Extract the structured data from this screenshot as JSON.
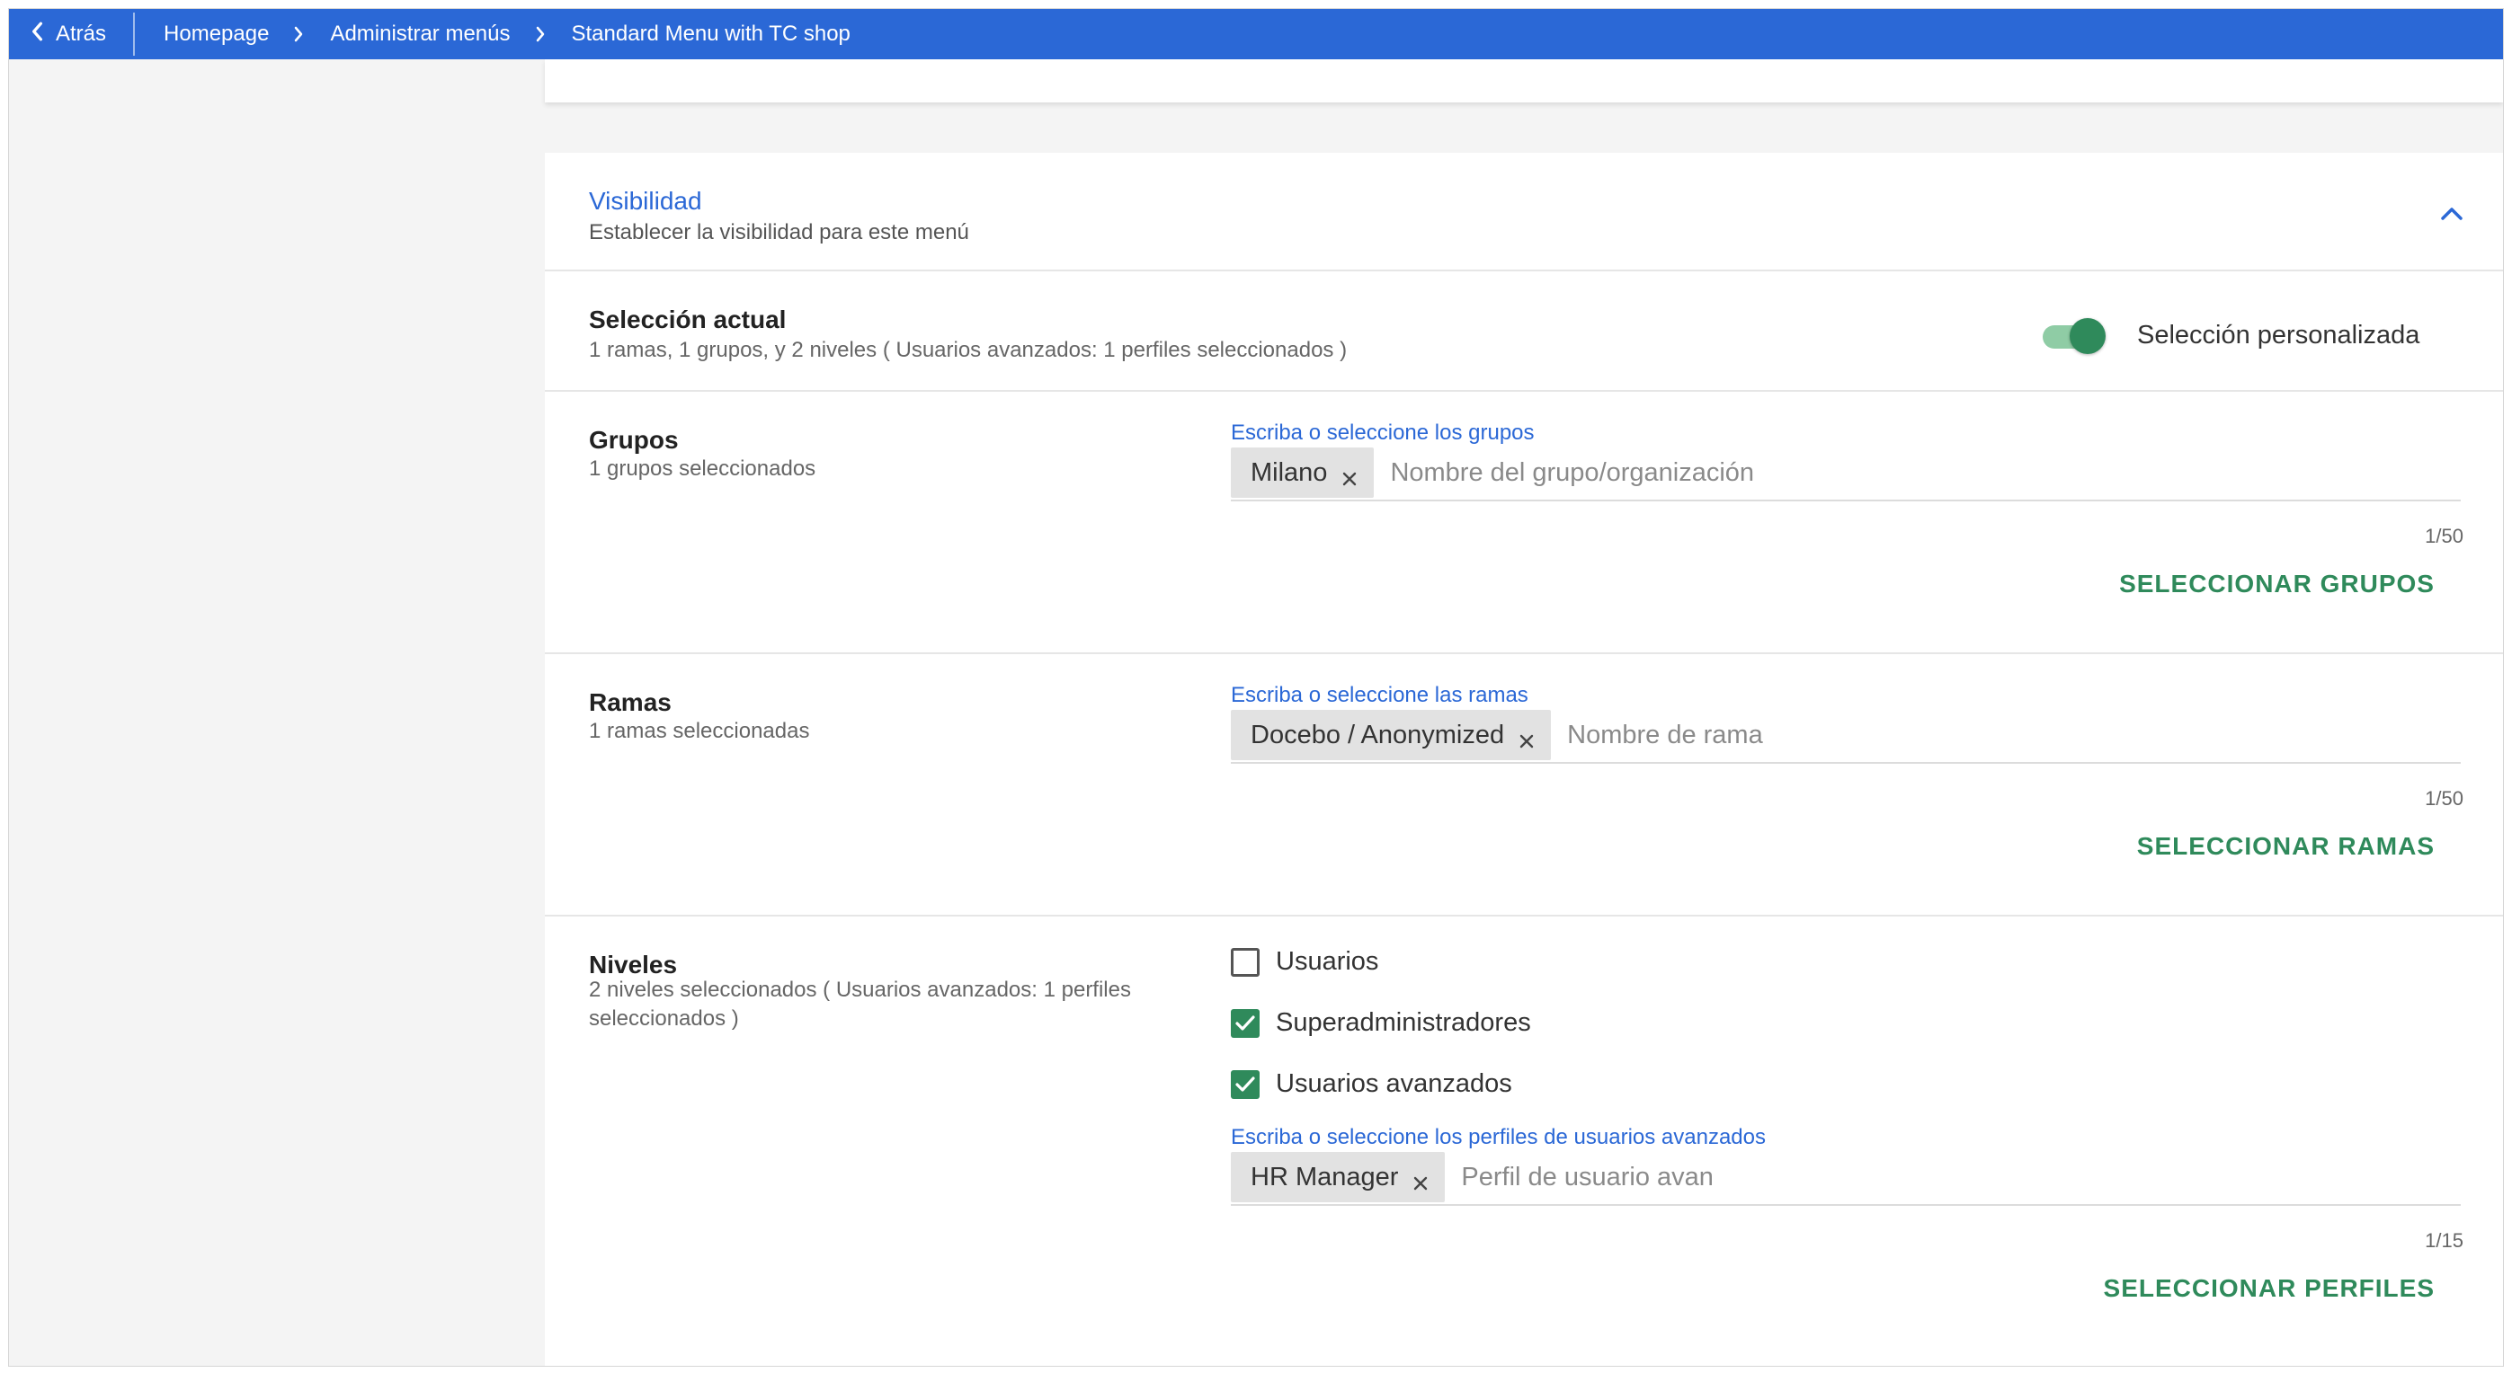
{
  "topbar": {
    "back_label": "Atrás",
    "breadcrumbs": [
      "Homepage",
      "Administrar menús",
      "Standard Menu with TC shop"
    ]
  },
  "visibility": {
    "title": "Visibilidad",
    "subtitle": "Establecer la visibilidad para este menú"
  },
  "current_selection": {
    "title": "Selección actual",
    "summary": "1 ramas, 1 grupos, y 2 niveles ( Usuarios avanzados: 1 perfiles seleccionados )",
    "toggle_label": "Selección personalizada",
    "toggle_on": true
  },
  "groups": {
    "title": "Grupos",
    "summary": "1 grupos seleccionados",
    "field_label": "Escriba o seleccione los grupos",
    "chips": [
      "Milano"
    ],
    "placeholder": "Nombre del grupo/organización",
    "counter": "1/50",
    "action": "SELECCIONAR GRUPOS"
  },
  "branches": {
    "title": "Ramas",
    "summary": "1 ramas seleccionadas",
    "field_label": "Escriba o seleccione las ramas",
    "chips": [
      "Docebo / Anonymized"
    ],
    "placeholder": "Nombre de rama",
    "counter": "1/50",
    "action": "SELECCIONAR RAMAS"
  },
  "levels": {
    "title": "Niveles",
    "summary": "2 niveles seleccionados ( Usuarios avanzados: 1 perfiles seleccionados )",
    "options": [
      {
        "label": "Usuarios",
        "checked": false
      },
      {
        "label": "Superadministradores",
        "checked": true
      },
      {
        "label": "Usuarios avanzados",
        "checked": true
      }
    ],
    "field_label": "Escriba o seleccione los perfiles de usuarios avanzados",
    "chips": [
      "HR Manager"
    ],
    "placeholder": "Perfil de usuario avan",
    "counter": "1/15",
    "action": "SELECCIONAR PERFILES"
  },
  "colors": {
    "primary_blue": "#2b68d6",
    "accent_green": "#2f8a5b",
    "toggle_track": "#8fcca5"
  },
  "icons": [
    "chevron-left-icon",
    "chevron-right-icon",
    "chevron-up-icon",
    "close-icon",
    "check-icon"
  ]
}
